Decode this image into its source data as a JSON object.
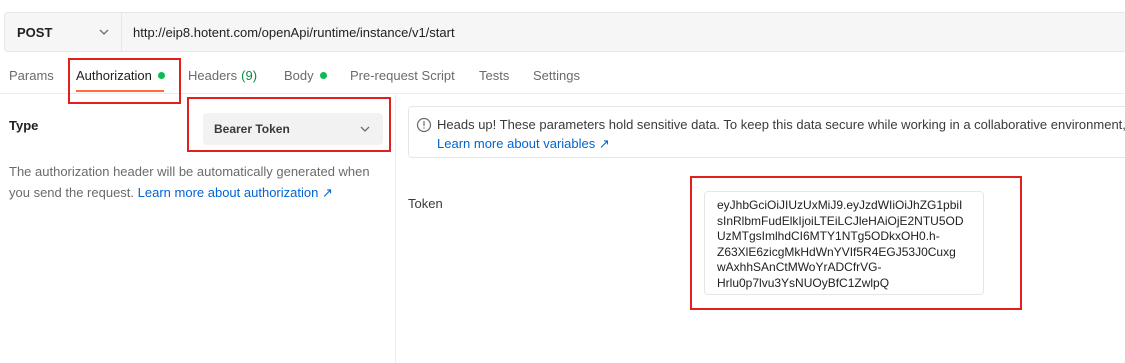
{
  "request": {
    "method": "POST",
    "url": "http://eip8.hotent.com/openApi/runtime/instance/v1/start"
  },
  "tabs": [
    {
      "label": "Params"
    },
    {
      "label": "Authorization"
    },
    {
      "label": "Headers",
      "count": "(9)"
    },
    {
      "label": "Body"
    },
    {
      "label": "Pre-request Script"
    },
    {
      "label": "Tests"
    },
    {
      "label": "Settings"
    }
  ],
  "auth": {
    "type_label": "Type",
    "type_value": "Bearer Token",
    "description": "The authorization header will be automatically generated when you send the request.",
    "learn_more": "Learn more about authorization ↗"
  },
  "notice": {
    "text": "Heads up! These parameters hold sensitive data. To keep this data secure while working in a collaborative environment, w",
    "link": "Learn more about variables ↗"
  },
  "token": {
    "label": "Token",
    "lines": [
      "eyJhbGciOiJIUzUxMiJ9.eyJzdWIiOiJhZG1pbiI",
      "sInRlbmFudElkIjoiLTEiLCJleHAiOjE2NTU5OD",
      "UzMTgsImlhdCI6MTY1NTg5ODkxOH0.h-",
      "Z63XlE6zicgMkHdWnYVIf5R4EGJ53J0Cuxg",
      "wAxhhSAnCtMWoYrADCfrVG-",
      "Hrlu0p7lvu3YsNUOyBfC1ZwlpQ"
    ]
  },
  "colors": {
    "accent": "#ff6c37",
    "active_dot": "#0cbb52",
    "link": "#0265d2",
    "highlight": "#e0201c"
  },
  "icons": [
    "chevron-down-icon",
    "info-icon"
  ]
}
